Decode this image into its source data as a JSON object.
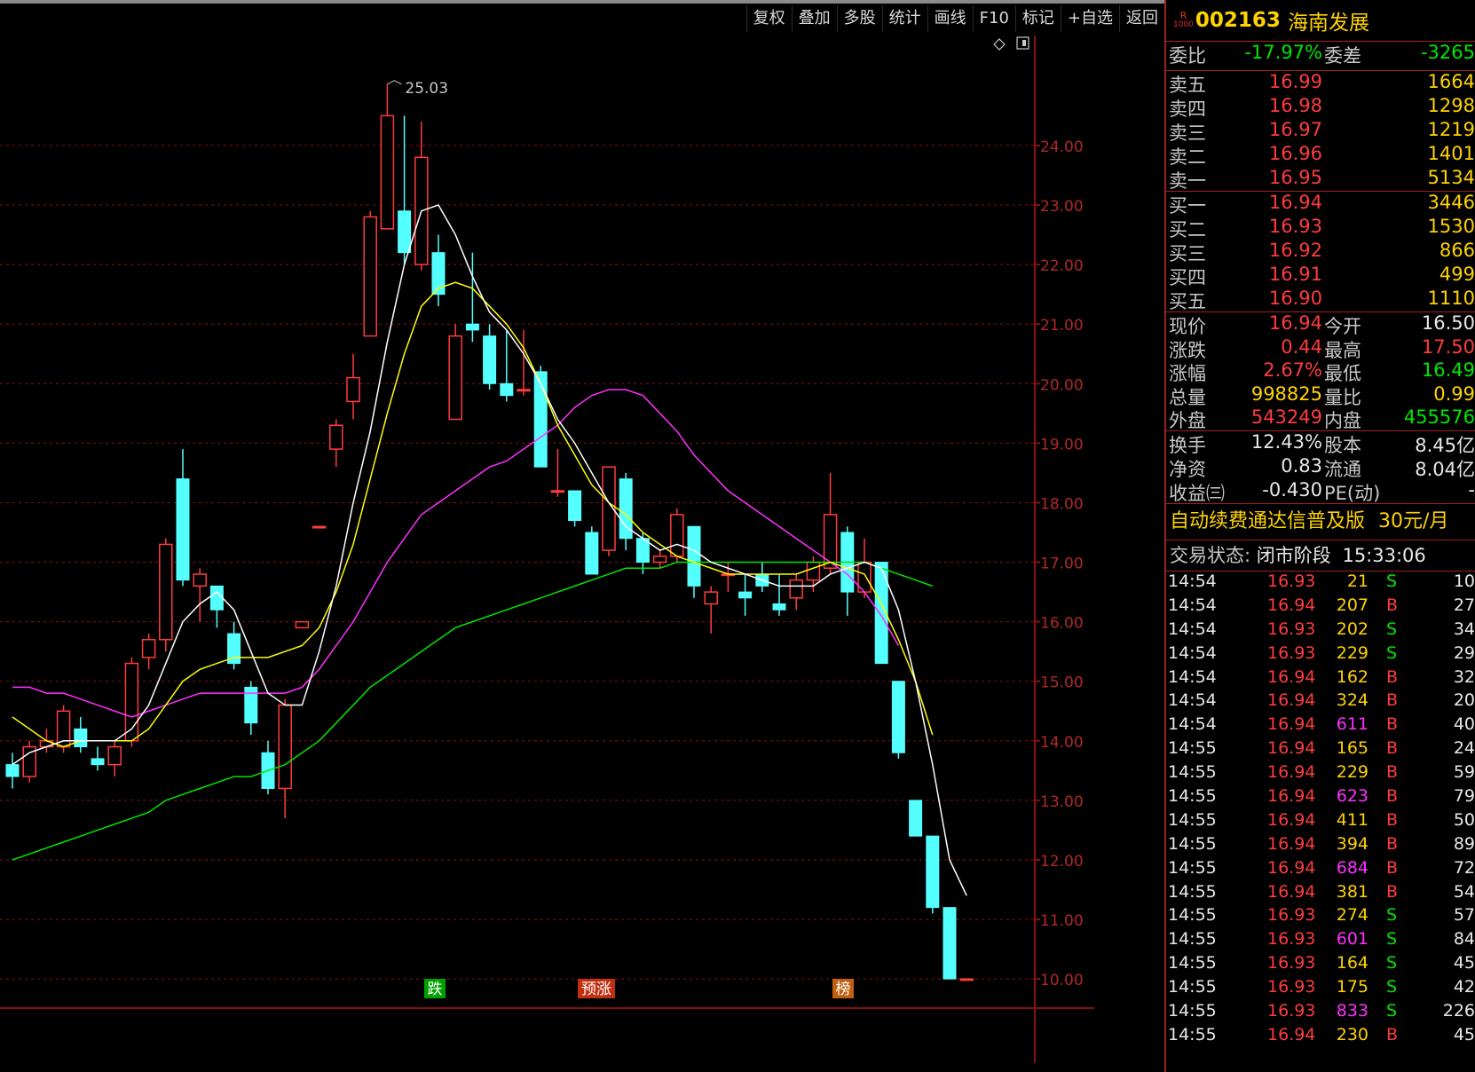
{
  "toolbar": {
    "buttons": [
      "复权",
      "叠加",
      "多股",
      "统计",
      "画线",
      "F10",
      "标记",
      "+自选",
      "返回"
    ]
  },
  "colors": {
    "up": "#ff3c3c",
    "down": "#54ffff",
    "ma5": "#ffffff",
    "ma10": "#ffff00",
    "ma20": "#ff30ff",
    "ma60": "#00e600",
    "grid": "#8a1010"
  },
  "chart_data": {
    "type": "candlestick",
    "y_axis_ticks": [
      "24.00",
      "23.00",
      "22.00",
      "21.00",
      "20.00",
      "19.00",
      "18.00",
      "17.00",
      "16.00",
      "15.00",
      "14.00",
      "13.00",
      "12.00",
      "11.00",
      "10.00"
    ],
    "ylim": [
      9.6,
      25.4
    ],
    "high_annotation": "25.03",
    "markers": [
      "跌",
      "预涨",
      "榜"
    ],
    "candles": [
      {
        "o": 13.6,
        "c": 13.4,
        "h": 13.8,
        "l": 13.2
      },
      {
        "o": 13.4,
        "c": 13.9,
        "h": 14.0,
        "l": 13.3
      },
      {
        "o": 13.9,
        "c": 14.0,
        "h": 14.2,
        "l": 13.8
      },
      {
        "o": 13.9,
        "c": 14.5,
        "h": 14.6,
        "l": 13.8
      },
      {
        "o": 14.2,
        "c": 13.9,
        "h": 14.4,
        "l": 13.8
      },
      {
        "o": 13.7,
        "c": 13.6,
        "h": 13.9,
        "l": 13.5
      },
      {
        "o": 13.6,
        "c": 13.9,
        "h": 14.0,
        "l": 13.4
      },
      {
        "o": 14.0,
        "c": 15.3,
        "h": 15.4,
        "l": 13.9
      },
      {
        "o": 15.4,
        "c": 15.7,
        "h": 15.8,
        "l": 15.2
      },
      {
        "o": 15.7,
        "c": 17.3,
        "h": 17.4,
        "l": 15.5
      },
      {
        "o": 18.4,
        "c": 16.7,
        "h": 18.9,
        "l": 16.6
      },
      {
        "o": 16.6,
        "c": 16.8,
        "h": 16.9,
        "l": 16.0
      },
      {
        "o": 16.6,
        "c": 16.2,
        "h": 16.6,
        "l": 15.9
      },
      {
        "o": 15.8,
        "c": 15.3,
        "h": 16.0,
        "l": 15.2
      },
      {
        "o": 14.9,
        "c": 14.3,
        "h": 15.0,
        "l": 14.1
      },
      {
        "o": 13.8,
        "c": 13.2,
        "h": 14.0,
        "l": 13.1
      },
      {
        "o": 13.2,
        "c": 14.6,
        "h": 14.7,
        "l": 12.7
      },
      {
        "o": 15.9,
        "c": 16.0,
        "h": 16.0,
        "l": 15.9
      },
      {
        "o": 17.6,
        "c": 17.6,
        "h": 17.6,
        "l": 17.6
      },
      {
        "o": 18.9,
        "c": 19.3,
        "h": 19.4,
        "l": 18.6
      },
      {
        "o": 19.7,
        "c": 20.1,
        "h": 20.5,
        "l": 19.4
      },
      {
        "o": 20.8,
        "c": 22.8,
        "h": 22.9,
        "l": 20.8
      },
      {
        "o": 22.6,
        "c": 24.5,
        "h": 25.03,
        "l": 22.6
      },
      {
        "o": 22.9,
        "c": 22.2,
        "h": 24.5,
        "l": 22.0
      },
      {
        "o": 22.0,
        "c": 23.8,
        "h": 24.4,
        "l": 21.9
      },
      {
        "o": 22.2,
        "c": 21.5,
        "h": 22.5,
        "l": 21.3
      },
      {
        "o": 19.4,
        "c": 20.8,
        "h": 21.0,
        "l": 19.4
      },
      {
        "o": 21.0,
        "c": 20.9,
        "h": 22.2,
        "l": 20.7
      },
      {
        "o": 20.8,
        "c": 20.0,
        "h": 21.0,
        "l": 19.9
      },
      {
        "o": 20.0,
        "c": 19.8,
        "h": 20.9,
        "l": 19.7
      },
      {
        "o": 19.9,
        "c": 19.9,
        "h": 20.9,
        "l": 19.8
      },
      {
        "o": 20.2,
        "c": 18.6,
        "h": 20.3,
        "l": 18.6
      },
      {
        "o": 18.2,
        "c": 18.2,
        "h": 18.9,
        "l": 18.1
      },
      {
        "o": 18.2,
        "c": 17.7,
        "h": 18.2,
        "l": 17.6
      },
      {
        "o": 17.5,
        "c": 16.8,
        "h": 17.6,
        "l": 16.8
      },
      {
        "o": 17.2,
        "c": 18.6,
        "h": 18.6,
        "l": 17.1
      },
      {
        "o": 18.4,
        "c": 17.4,
        "h": 18.5,
        "l": 17.2
      },
      {
        "o": 17.4,
        "c": 17.0,
        "h": 17.5,
        "l": 16.8
      },
      {
        "o": 17.0,
        "c": 17.1,
        "h": 17.2,
        "l": 16.9
      },
      {
        "o": 17.1,
        "c": 17.8,
        "h": 17.9,
        "l": 17.0
      },
      {
        "o": 17.6,
        "c": 16.6,
        "h": 17.6,
        "l": 16.4
      },
      {
        "o": 16.3,
        "c": 16.5,
        "h": 16.6,
        "l": 15.8
      },
      {
        "o": 16.8,
        "c": 16.8,
        "h": 17.0,
        "l": 16.5
      },
      {
        "o": 16.5,
        "c": 16.4,
        "h": 16.8,
        "l": 16.1
      },
      {
        "o": 16.8,
        "c": 16.6,
        "h": 17.0,
        "l": 16.5
      },
      {
        "o": 16.3,
        "c": 16.2,
        "h": 16.8,
        "l": 16.1
      },
      {
        "o": 16.4,
        "c": 16.7,
        "h": 16.8,
        "l": 16.2
      },
      {
        "o": 16.7,
        "c": 17.0,
        "h": 17.1,
        "l": 16.5
      },
      {
        "o": 16.9,
        "c": 17.8,
        "h": 18.5,
        "l": 16.8
      },
      {
        "o": 17.5,
        "c": 16.5,
        "h": 17.6,
        "l": 16.1
      },
      {
        "o": 16.5,
        "c": 17.0,
        "h": 17.4,
        "l": 16.4
      },
      {
        "o": 17.0,
        "c": 15.3,
        "h": 17.0,
        "l": 15.3
      },
      {
        "o": 15.0,
        "c": 13.8,
        "h": 15.0,
        "l": 13.7
      },
      {
        "o": 13.0,
        "c": 12.4,
        "h": 13.0,
        "l": 12.4
      },
      {
        "o": 12.4,
        "c": 11.2,
        "h": 12.4,
        "l": 11.1
      },
      {
        "o": 11.2,
        "c": 10.0,
        "h": 11.2,
        "l": 10.0
      },
      {
        "o": 10.0,
        "c": 10.0,
        "h": 10.0,
        "l": 10.0
      }
    ],
    "ma5": [
      13.6,
      13.8,
      13.9,
      14.0,
      14.0,
      14.0,
      14.0,
      14.2,
      14.6,
      15.3,
      16.0,
      16.3,
      16.5,
      16.2,
      15.5,
      14.8,
      14.6,
      14.6,
      15.5,
      16.6,
      18.0,
      19.2,
      20.7,
      22.0,
      22.9,
      23.0,
      22.5,
      21.8,
      21.2,
      20.9,
      20.5,
      20.0,
      19.4,
      19.0,
      18.5,
      18.0,
      17.6,
      17.4,
      17.2,
      17.3,
      17.2,
      17.0,
      16.9,
      16.8,
      16.7,
      16.6,
      16.6,
      16.6,
      16.8,
      16.9,
      17.0,
      16.9,
      16.2,
      15.0,
      13.6,
      12.0,
      11.4
    ],
    "ma10": [
      14.4,
      14.2,
      14.0,
      13.9,
      14.0,
      14.0,
      14.0,
      14.0,
      14.2,
      14.6,
      15.0,
      15.2,
      15.3,
      15.4,
      15.4,
      15.4,
      15.5,
      15.6,
      15.9,
      16.5,
      17.3,
      18.4,
      19.5,
      20.5,
      21.3,
      21.6,
      21.7,
      21.6,
      21.3,
      21.0,
      20.6,
      20.0,
      19.3,
      18.8,
      18.3,
      18.0,
      17.8,
      17.5,
      17.3,
      17.1,
      17.0,
      16.9,
      16.8,
      16.8,
      16.8,
      16.8,
      16.8,
      16.9,
      17.0,
      16.9,
      16.8,
      16.3,
      15.7,
      15.0,
      14.1
    ],
    "ma20": [
      14.9,
      14.9,
      14.8,
      14.8,
      14.7,
      14.6,
      14.5,
      14.4,
      14.5,
      14.6,
      14.7,
      14.8,
      14.8,
      14.8,
      14.8,
      14.8,
      14.8,
      14.9,
      15.2,
      15.6,
      16.0,
      16.5,
      17.0,
      17.4,
      17.8,
      18.0,
      18.2,
      18.4,
      18.6,
      18.7,
      18.9,
      19.1,
      19.3,
      19.6,
      19.8,
      19.9,
      19.9,
      19.8,
      19.5,
      19.2,
      18.8,
      18.5,
      18.2,
      18.0,
      17.8,
      17.6,
      17.4,
      17.2,
      17.0,
      16.8,
      16.5,
      16.1,
      15.6
    ],
    "ma60": [
      12.0,
      12.1,
      12.2,
      12.3,
      12.4,
      12.5,
      12.6,
      12.7,
      12.8,
      13.0,
      13.1,
      13.2,
      13.3,
      13.4,
      13.4,
      13.5,
      13.6,
      13.8,
      14.0,
      14.3,
      14.6,
      14.9,
      15.1,
      15.3,
      15.5,
      15.7,
      15.9,
      16.0,
      16.1,
      16.2,
      16.3,
      16.4,
      16.5,
      16.6,
      16.7,
      16.8,
      16.9,
      16.9,
      16.9,
      17.0,
      17.0,
      17.0,
      17.0,
      17.0,
      17.0,
      17.0,
      17.0,
      17.0,
      17.0,
      17.0,
      17.0,
      16.9,
      16.8,
      16.7,
      16.6
    ]
  },
  "stock": {
    "badge_r": "R",
    "badge_n": "1000",
    "code": "002163",
    "name": "海南发展",
    "weibi_label": "委比",
    "weibi": "-17.97%",
    "weicha_label": "委差",
    "weicha": "-3265",
    "asks": [
      {
        "label": "卖五",
        "price": "16.99",
        "vol": "1664"
      },
      {
        "label": "卖四",
        "price": "16.98",
        "vol": "1298"
      },
      {
        "label": "卖三",
        "price": "16.97",
        "vol": "1219"
      },
      {
        "label": "卖二",
        "price": "16.96",
        "vol": "1401"
      },
      {
        "label": "卖一",
        "price": "16.95",
        "vol": "5134"
      }
    ],
    "bids": [
      {
        "label": "买一",
        "price": "16.94",
        "vol": "3446"
      },
      {
        "label": "买二",
        "price": "16.93",
        "vol": "1530"
      },
      {
        "label": "买三",
        "price": "16.92",
        "vol": "866"
      },
      {
        "label": "买四",
        "price": "16.91",
        "vol": "499"
      },
      {
        "label": "买五",
        "price": "16.90",
        "vol": "1110"
      }
    ],
    "quote": [
      {
        "l1": "现价",
        "v1": "16.94",
        "c1": "red",
        "l2": "今开",
        "v2": "16.50",
        "c2": "white"
      },
      {
        "l1": "涨跌",
        "v1": "0.44",
        "c1": "red",
        "l2": "最高",
        "v2": "17.50",
        "c2": "red"
      },
      {
        "l1": "涨幅",
        "v1": "2.67%",
        "c1": "red",
        "l2": "最低",
        "v2": "16.49",
        "c2": "green"
      },
      {
        "l1": "总量",
        "v1": "998825",
        "c1": "yellow",
        "l2": "量比",
        "v2": "0.99",
        "c2": "yellow"
      },
      {
        "l1": "外盘",
        "v1": "543249",
        "c1": "red",
        "l2": "内盘",
        "v2": "455576",
        "c2": "green"
      }
    ],
    "fund": [
      {
        "l1": "换手",
        "v1": "12.43%",
        "l2": "股本",
        "v2": "8.45亿"
      },
      {
        "l1": "净资",
        "v1": "0.83",
        "l2": "流通",
        "v2": "8.04亿"
      },
      {
        "l1": "收益㈢",
        "v1": "-0.430",
        "l2": "PE(动)",
        "v2": "-"
      }
    ],
    "ad_text": "自动续费通达信普及版",
    "ad_price": "30元/月",
    "status_label": "交易状态:",
    "status_value": "闭市阶段",
    "status_time": "15:33:06"
  },
  "ticks": [
    {
      "t": "14:54",
      "p": "16.93",
      "pc": "red",
      "v": "21",
      "vc": "yellow",
      "bs": "S",
      "n": "10"
    },
    {
      "t": "14:54",
      "p": "16.94",
      "pc": "red",
      "v": "207",
      "vc": "yellow",
      "bs": "B",
      "n": "27"
    },
    {
      "t": "14:54",
      "p": "16.93",
      "pc": "red",
      "v": "202",
      "vc": "yellow",
      "bs": "S",
      "n": "34"
    },
    {
      "t": "14:54",
      "p": "16.93",
      "pc": "red",
      "v": "229",
      "vc": "yellow",
      "bs": "S",
      "n": "29"
    },
    {
      "t": "14:54",
      "p": "16.94",
      "pc": "red",
      "v": "162",
      "vc": "yellow",
      "bs": "B",
      "n": "32"
    },
    {
      "t": "14:54",
      "p": "16.94",
      "pc": "red",
      "v": "324",
      "vc": "yellow",
      "bs": "B",
      "n": "20"
    },
    {
      "t": "14:54",
      "p": "16.94",
      "pc": "red",
      "v": "611",
      "vc": "magenta",
      "bs": "B",
      "n": "40"
    },
    {
      "t": "14:55",
      "p": "16.94",
      "pc": "red",
      "v": "165",
      "vc": "yellow",
      "bs": "B",
      "n": "24"
    },
    {
      "t": "14:55",
      "p": "16.94",
      "pc": "red",
      "v": "229",
      "vc": "yellow",
      "bs": "B",
      "n": "59"
    },
    {
      "t": "14:55",
      "p": "16.94",
      "pc": "red",
      "v": "623",
      "vc": "magenta",
      "bs": "B",
      "n": "79"
    },
    {
      "t": "14:55",
      "p": "16.94",
      "pc": "red",
      "v": "411",
      "vc": "yellow",
      "bs": "B",
      "n": "50"
    },
    {
      "t": "14:55",
      "p": "16.94",
      "pc": "red",
      "v": "394",
      "vc": "yellow",
      "bs": "B",
      "n": "89"
    },
    {
      "t": "14:55",
      "p": "16.94",
      "pc": "red",
      "v": "684",
      "vc": "magenta",
      "bs": "B",
      "n": "72"
    },
    {
      "t": "14:55",
      "p": "16.94",
      "pc": "red",
      "v": "381",
      "vc": "yellow",
      "bs": "B",
      "n": "54"
    },
    {
      "t": "14:55",
      "p": "16.93",
      "pc": "red",
      "v": "274",
      "vc": "yellow",
      "bs": "S",
      "n": "57"
    },
    {
      "t": "14:55",
      "p": "16.93",
      "pc": "red",
      "v": "601",
      "vc": "magenta",
      "bs": "S",
      "n": "84"
    },
    {
      "t": "14:55",
      "p": "16.93",
      "pc": "red",
      "v": "164",
      "vc": "yellow",
      "bs": "S",
      "n": "45"
    },
    {
      "t": "14:55",
      "p": "16.93",
      "pc": "red",
      "v": "175",
      "vc": "yellow",
      "bs": "S",
      "n": "42"
    },
    {
      "t": "14:55",
      "p": "16.93",
      "pc": "red",
      "v": "833",
      "vc": "magenta",
      "bs": "S",
      "n": "226"
    },
    {
      "t": "14:55",
      "p": "16.94",
      "pc": "red",
      "v": "230",
      "vc": "yellow",
      "bs": "B",
      "n": "45"
    }
  ]
}
